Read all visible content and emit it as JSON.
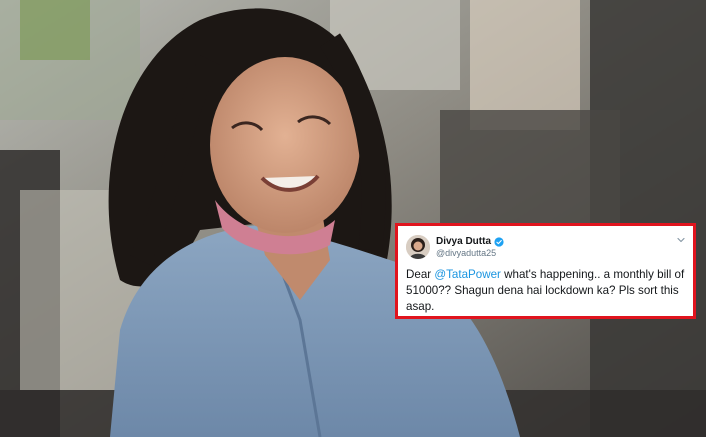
{
  "tweet": {
    "display_name": "Divya Dutta",
    "handle": "@divyadutta25",
    "text_before_mention": "Dear ",
    "mention": "@TataPower",
    "text_after_mention": " what's happening.. a monthly bill of 51000?? Shagun dena hai lockdown ka?  Pls sort this asap.",
    "icons": [
      "verified-badge-icon",
      "chevron-down-icon"
    ],
    "colors": {
      "highlight_border": "#e0141e",
      "mention": "#1b95e0",
      "verified": "#1da1f2"
    }
  }
}
